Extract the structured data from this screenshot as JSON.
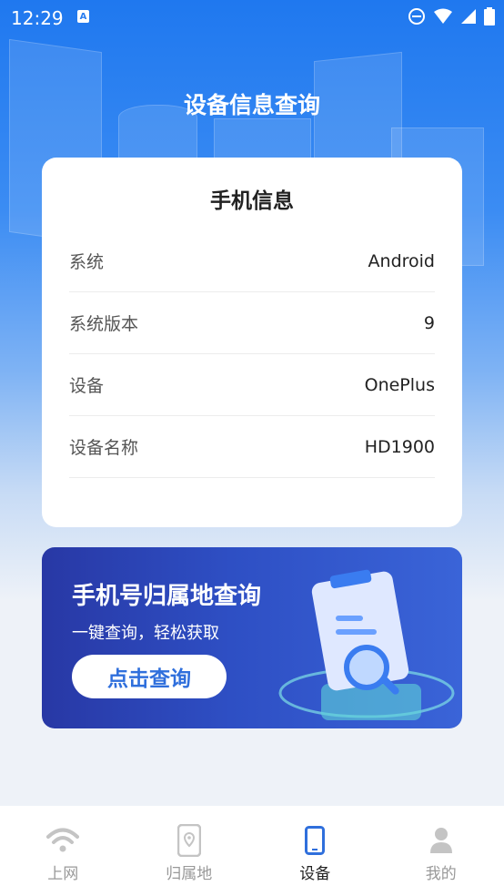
{
  "status_bar": {
    "time": "12:29",
    "badge": "A"
  },
  "page": {
    "title": "设备信息查询"
  },
  "info_card": {
    "title": "手机信息",
    "rows": [
      {
        "label": "系统",
        "value": "Android"
      },
      {
        "label": "系统版本",
        "value": "9"
      },
      {
        "label": "设备",
        "value": "OnePlus"
      },
      {
        "label": "设备名称",
        "value": "HD1900"
      }
    ]
  },
  "banner": {
    "title": "手机号归属地查询",
    "subtitle": "一键查询，轻松获取",
    "button": "点击查询"
  },
  "tabs": [
    {
      "label": "上网",
      "icon": "wifi-icon",
      "active": false
    },
    {
      "label": "归属地",
      "icon": "location-phone-icon",
      "active": false
    },
    {
      "label": "设备",
      "icon": "phone-icon",
      "active": true
    },
    {
      "label": "我的",
      "icon": "person-icon",
      "active": false
    }
  ],
  "colors": {
    "accent": "#2f6fdc",
    "active_tab": "#2f6fdc",
    "inactive_tab": "#bdbdbd"
  }
}
